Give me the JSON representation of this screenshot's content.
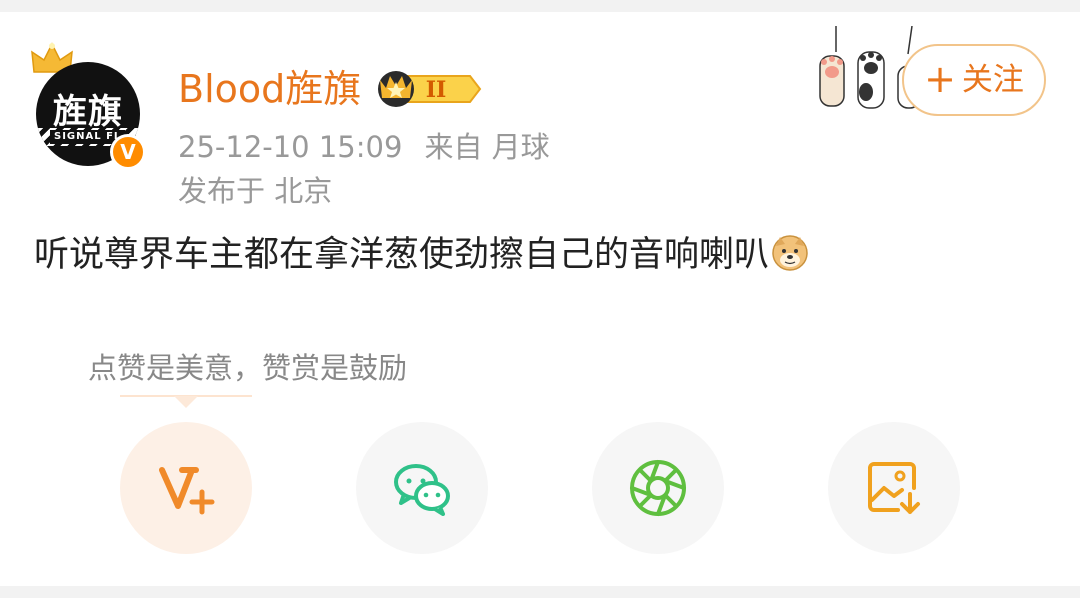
{
  "post": {
    "username": "Blood旌旗",
    "avatar_text": "旌旗",
    "avatar_subtext": "SIGNAL FL",
    "verified_badge": "V",
    "vip_level": "II",
    "timestamp": "25-12-10 15:09",
    "source": "来自 月球",
    "location": "发布于 北京",
    "text": "听说尊界车主都在拿洋葱使劲擦自己的音响喇叭",
    "emoji": "doge-emoji",
    "follow_plus": "+",
    "follow_label": "关注"
  },
  "tip": {
    "text": "点赞是美意，赞赏是鼓励"
  },
  "actions": [
    {
      "icon": "v-plus-icon"
    },
    {
      "icon": "wechat-icon"
    },
    {
      "icon": "moments-icon"
    },
    {
      "icon": "save-image-icon"
    }
  ],
  "colors": {
    "accent": "#e8761d",
    "meta_text": "#999999",
    "wechat_green": "#2fc189",
    "moments_green": "#5fbf3f",
    "background": "#f2f2f2"
  }
}
